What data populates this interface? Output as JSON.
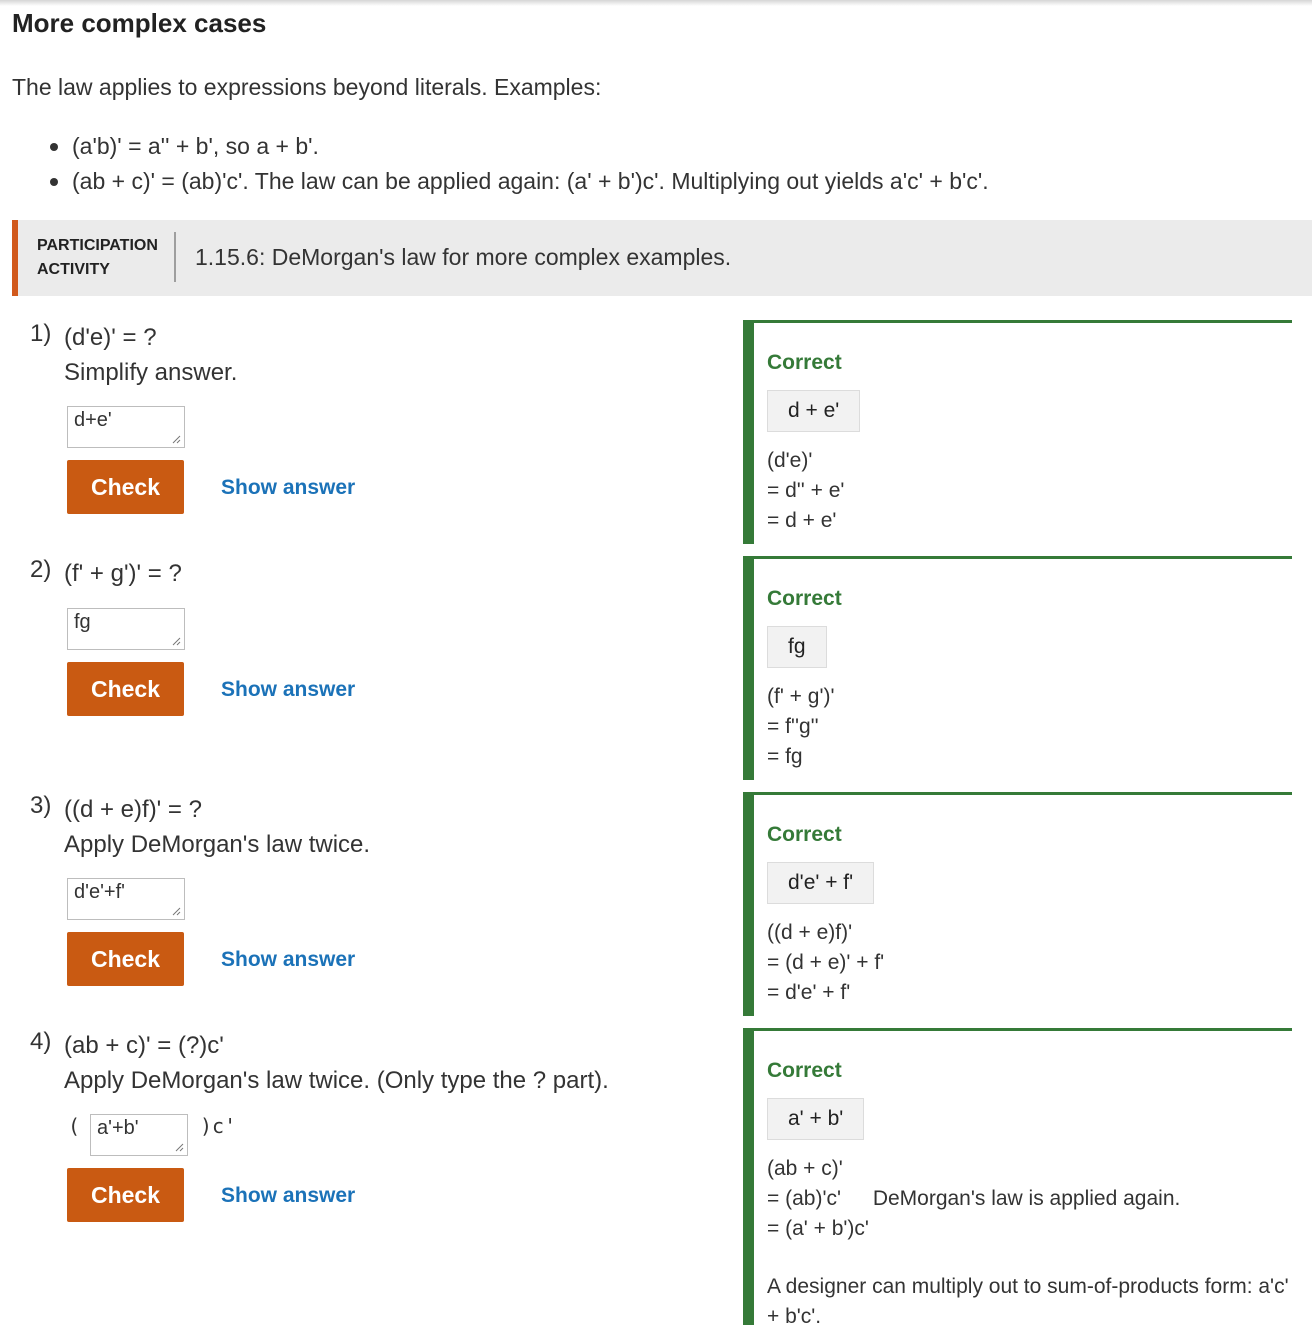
{
  "section": {
    "heading": "More complex cases",
    "intro": "The law applies to expressions beyond literals. Examples:",
    "bullets": [
      "(a'b)' = a'' + b', so a + b'.",
      "(ab + c)' = (ab)'c'. The law can be applied again: (a' + b')c'. Multiplying out yields a'c' + b'c'."
    ]
  },
  "activity": {
    "tag_line1": "PARTICIPATION",
    "tag_line2": "ACTIVITY",
    "title": "1.15.6: DeMorgan's law for more complex examples."
  },
  "questions": [
    {
      "number": "1)",
      "prompt": "(d'e)' = ?",
      "subprompt": "Simplify answer.",
      "input_value": "d+e'",
      "check_label": "Check",
      "show_answer_label": "Show answer",
      "feedback": {
        "status": "Correct",
        "answer": "d + e'",
        "lines": [
          "(d'e)'",
          "= d'' + e'",
          "= d + e'"
        ]
      }
    },
    {
      "number": "2)",
      "prompt": "(f' + g')' = ?",
      "subprompt": "",
      "input_value": "fg",
      "check_label": "Check",
      "show_answer_label": "Show answer",
      "feedback": {
        "status": "Correct",
        "answer": "fg",
        "lines": [
          "(f' + g')'",
          "= f''g''",
          "= fg"
        ]
      }
    },
    {
      "number": "3)",
      "prompt": "((d + e)f)' = ?",
      "subprompt": "Apply DeMorgan's law twice.",
      "input_value": "d'e'+f'",
      "check_label": "Check",
      "show_answer_label": "Show answer",
      "feedback": {
        "status": "Correct",
        "answer": "d'e' + f'",
        "lines": [
          "((d + e)f)'",
          "= (d + e)' + f'",
          "= d'e' + f'"
        ]
      }
    },
    {
      "number": "4)",
      "prompt": "(ab + c)' = (?)c'",
      "subprompt": "Apply DeMorgan's law twice. (Only type the ? part).",
      "prefix": "(",
      "suffix": ")c'",
      "input_value": "a'+b'",
      "check_label": "Check",
      "show_answer_label": "Show answer",
      "feedback": {
        "status": "Correct",
        "answer": "a' + b'",
        "lines": [
          "(ab + c)'",
          "= (ab)'c'",
          "= (a' + b')c'"
        ],
        "line_note": "DeMorgan's law is applied again.",
        "note": "A designer can multiply out to sum-of-products form: a'c' + b'c'."
      }
    }
  ],
  "colors": {
    "accent_orange": "#c95a12",
    "activity_bar": "#d1591c",
    "correct_green": "#357a38",
    "link_blue": "#1b72b8"
  }
}
